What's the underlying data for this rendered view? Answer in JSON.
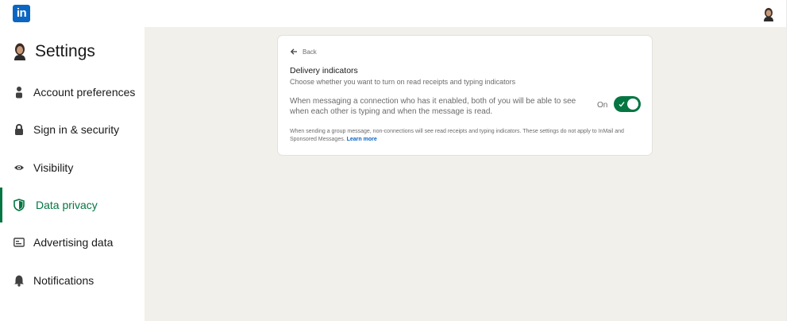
{
  "topbar": {
    "logo_text": "in",
    "avatar_icon": "profile-avatar"
  },
  "sidebar": {
    "title": "Settings",
    "items": [
      {
        "label": "Account preferences",
        "icon": "person-icon",
        "active": false
      },
      {
        "label": "Sign in & security",
        "icon": "lock-icon",
        "active": false
      },
      {
        "label": "Visibility",
        "icon": "eye-icon",
        "active": false
      },
      {
        "label": "Data privacy",
        "icon": "shield-icon",
        "active": true
      },
      {
        "label": "Advertising data",
        "icon": "id-card-icon",
        "active": false
      },
      {
        "label": "Notifications",
        "icon": "bell-icon",
        "active": false
      }
    ]
  },
  "card": {
    "back_label": "Back",
    "title": "Delivery indicators",
    "subtitle": "Choose whether you want to turn on read receipts and typing indicators",
    "setting_description": "When messaging a connection who has it enabled, both of you will be able to see when each other is typing and when the message is read.",
    "toggle_state": "On",
    "footnote_text": "When sending a group message, non-connections will see read receipts and typing indicators. These settings do not apply to InMail and Sponsored Messages.",
    "footnote_link": "Learn more"
  },
  "colors": {
    "brand": "#0a66c2",
    "active": "#057642",
    "main_bg": "#f2f0eb"
  }
}
